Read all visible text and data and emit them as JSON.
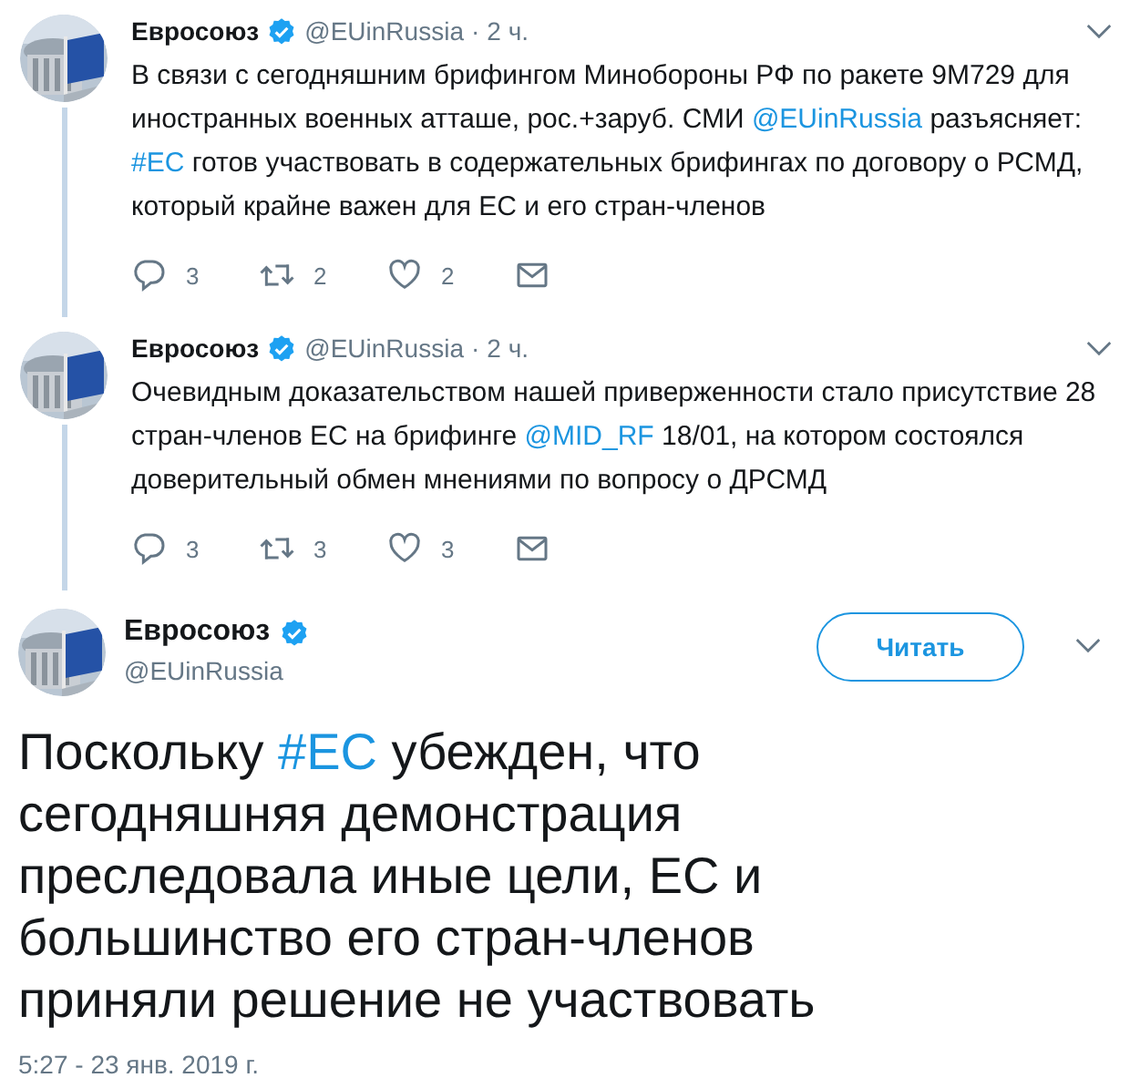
{
  "thread": [
    {
      "name": "Евросоюз",
      "verified": true,
      "handle": "@EUinRussia",
      "separator": "·",
      "time": "2 ч.",
      "text": [
        {
          "kind": "text",
          "text": "В связи с сегодняшним брифингом Минобороны РФ по ракете 9М729 для иностранных военных атташе, рос.+заруб. СМИ "
        },
        {
          "kind": "mention",
          "text": "@EUinRussia"
        },
        {
          "kind": "text",
          "text": " разъясняет: "
        },
        {
          "kind": "hashtag",
          "text": "#ЕС"
        },
        {
          "kind": "text",
          "text": " готов участвовать в содержательных брифингах по договору о РСМД, который крайне важен для ЕС и его стран-членов"
        }
      ],
      "replies": "3",
      "retweets": "2",
      "likes": "2"
    },
    {
      "name": "Евросоюз",
      "verified": true,
      "handle": "@EUinRussia",
      "separator": "·",
      "time": "2 ч.",
      "text": [
        {
          "kind": "text",
          "text": "Очевидным доказательством нашей приверженности стало присутствие 28 стран-членов ЕС на брифинге "
        },
        {
          "kind": "mention",
          "text": "@MID_RF"
        },
        {
          "kind": "text",
          "text": " 18/01, на котором состоялся доверительный обмен мнениями по вопросу о ДРСМД"
        }
      ],
      "replies": "3",
      "retweets": "3",
      "likes": "3"
    }
  ],
  "main_tweet": {
    "name": "Евросоюз",
    "verified": true,
    "handle": "@EUinRussia",
    "follow_button": "Читать",
    "text": [
      {
        "kind": "text",
        "text": "Поскольку "
      },
      {
        "kind": "hashtag",
        "text": "#ЕС"
      },
      {
        "kind": "text",
        "text": " убежден, что сегодняшняя демонстрация преследовала иные цели, ЕС и большинство его стран-членов приняли решение не участвовать"
      }
    ],
    "timestamp": "5:27 - 23 янв. 2019 г."
  }
}
